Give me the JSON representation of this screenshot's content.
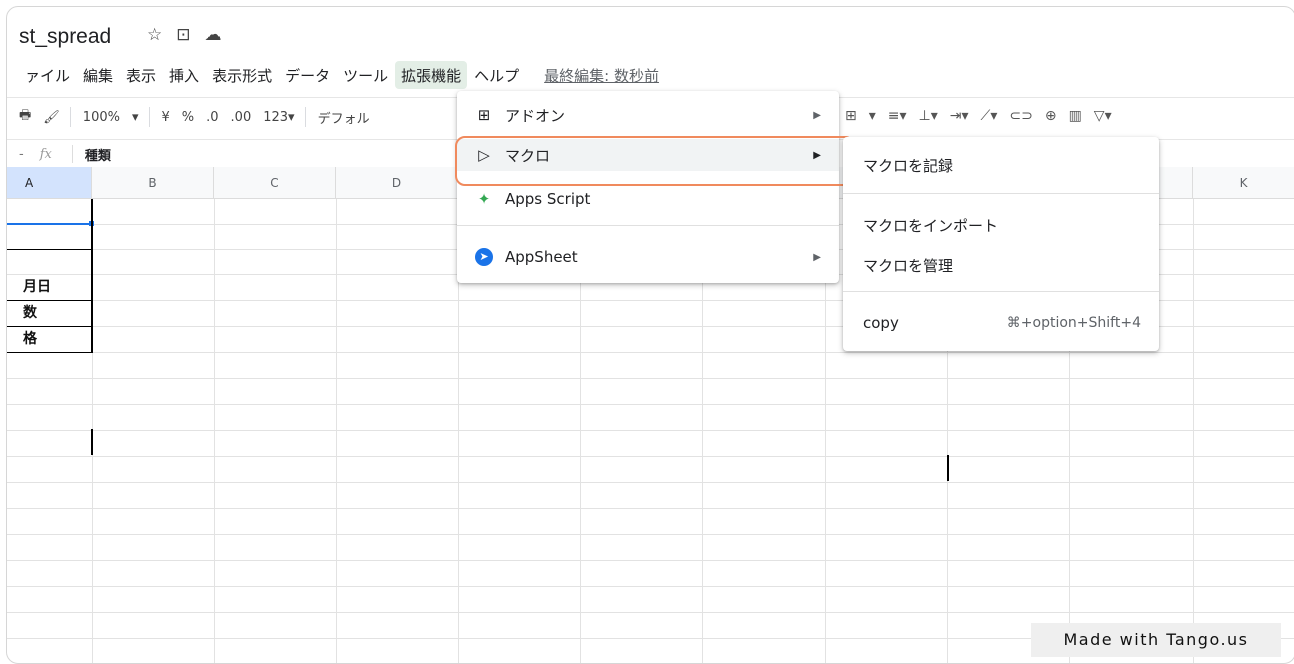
{
  "doc": {
    "title": "st_spread",
    "title_icons": [
      "star-icon",
      "move-folder-icon",
      "cloud-icon"
    ]
  },
  "menubar": {
    "items": [
      "ァイル",
      "編集",
      "表示",
      "挿入",
      "表示形式",
      "データ",
      "ツール",
      "拡張機能",
      "ヘルプ"
    ],
    "active": "拡張機能",
    "last_edit": "最終編集: 数秒前"
  },
  "toolbar": {
    "zoom": "100%",
    "currency": "¥",
    "percent": "%",
    "dec_decrease": ".0",
    "dec_increase": ".00",
    "format": "123▾",
    "font": "デフォル"
  },
  "formula_bar": {
    "fx": "fx",
    "content": "種類"
  },
  "columns": [
    "A",
    "B",
    "C",
    "D",
    "K"
  ],
  "cells_a": [
    "月日",
    "数",
    "格"
  ],
  "extensions_menu": {
    "items": [
      {
        "label": "アドオン",
        "icon": "addon-icon"
      },
      {
        "label": "マクロ",
        "icon": "play-circle-icon"
      },
      {
        "label": "Apps Script",
        "icon": "apps-script-icon"
      },
      {
        "label": "AppSheet",
        "icon": "appsheet-icon"
      }
    ]
  },
  "macro_submenu": {
    "record": "マクロを記録",
    "import": "マクロをインポート",
    "manage": "マクロを管理",
    "copy_name": "copy",
    "copy_shortcut": "⌘+option+Shift+4"
  },
  "watermark": "Made with Tango.us"
}
